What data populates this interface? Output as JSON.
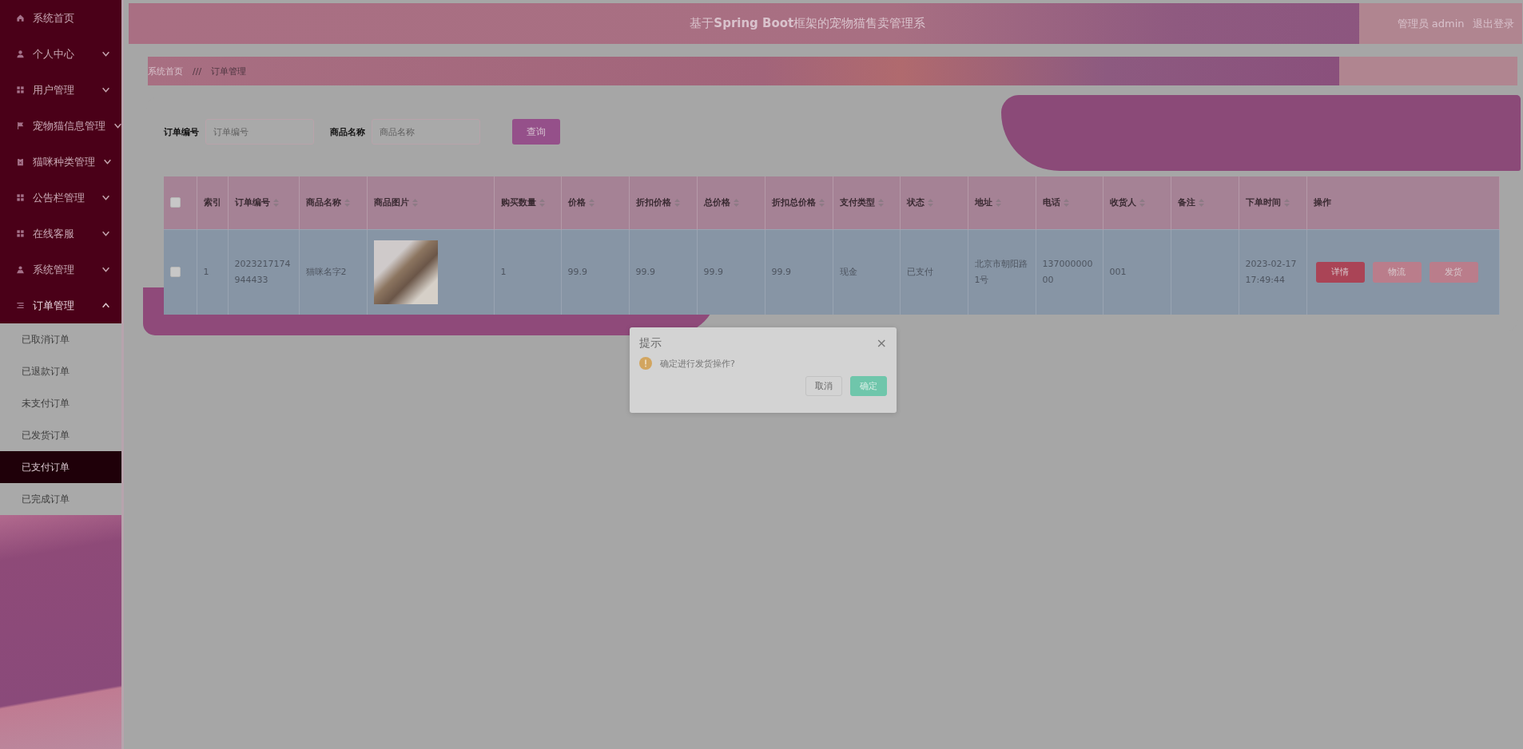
{
  "sidebar": {
    "items": [
      {
        "label": "系统首页",
        "kind": "link"
      },
      {
        "label": "个人中心",
        "kind": "menu",
        "expanded": false
      },
      {
        "label": "用户管理",
        "kind": "menu",
        "expanded": false
      },
      {
        "label": "宠物猫信息管理",
        "kind": "menu",
        "expanded": false
      },
      {
        "label": "猫咪种类管理",
        "kind": "menu",
        "expanded": false
      },
      {
        "label": "公告栏管理",
        "kind": "menu",
        "expanded": false
      },
      {
        "label": "在线客服",
        "kind": "menu",
        "expanded": false
      },
      {
        "label": "系统管理",
        "kind": "menu",
        "expanded": false
      },
      {
        "label": "订单管理",
        "kind": "menu",
        "expanded": true,
        "children": [
          {
            "label": "已取消订单",
            "selected": false
          },
          {
            "label": "已退款订单",
            "selected": false
          },
          {
            "label": "未支付订单",
            "selected": false
          },
          {
            "label": "已发货订单",
            "selected": false
          },
          {
            "label": "已支付订单",
            "selected": true
          },
          {
            "label": "已完成订单",
            "selected": false
          }
        ]
      }
    ]
  },
  "header": {
    "title": "基于**Spring Boot**框架的宠物猫售卖管理系",
    "user": "管理员 admin",
    "logout": "退出登录"
  },
  "breadcrumb": [
    "系统首页",
    "///",
    "订单管理"
  ],
  "filters": [
    {
      "label": "订单编号",
      "placeholder": "订单编号"
    },
    {
      "label": "商品名称",
      "placeholder": "商品名称"
    }
  ],
  "search_button": "查询",
  "table": {
    "columns": [
      {
        "kind": "checkbox",
        "sortable": false,
        "checked": false
      },
      {
        "label": "索引",
        "kind": "text",
        "sortable": false
      },
      {
        "label": "订单编号",
        "kind": "text",
        "sortable": true
      },
      {
        "label": "商品名称",
        "kind": "text",
        "sortable": true
      },
      {
        "label": "商品图片",
        "kind": "image",
        "sortable": true
      },
      {
        "label": "购买数量",
        "kind": "text",
        "sortable": true
      },
      {
        "label": "价格",
        "kind": "text",
        "sortable": true
      },
      {
        "label": "折扣价格",
        "kind": "text",
        "sortable": true
      },
      {
        "label": "总价格",
        "kind": "text",
        "sortable": true
      },
      {
        "label": "折扣总价格",
        "kind": "text",
        "sortable": true
      },
      {
        "label": "支付类型",
        "kind": "text",
        "sortable": true
      },
      {
        "label": "状态",
        "kind": "text",
        "sortable": true
      },
      {
        "label": "地址",
        "kind": "text",
        "sortable": true
      },
      {
        "label": "电话",
        "kind": "text",
        "sortable": true
      },
      {
        "label": "收货人",
        "kind": "text",
        "sortable": true
      },
      {
        "label": "备注",
        "kind": "text",
        "sortable": true
      },
      {
        "label": "下单时间",
        "kind": "text",
        "sortable": true
      },
      {
        "label": "操作",
        "kind": "actions",
        "sortable": false
      }
    ],
    "rows": [
      {
        "checked": false,
        "cells": [
          "",
          "1",
          "2023217174944433",
          "猫咪名字2",
          "",
          "1",
          "99.9",
          "99.9",
          "99.9",
          "99.9",
          "现金",
          "已支付",
          "北京市朝阳路1号",
          "13700000000",
          "001",
          "",
          "2023-02-17 17:49:44",
          ""
        ],
        "actions": [
          {
            "label": "详情",
            "kind": "primary"
          },
          {
            "label": "物流",
            "kind": "secondary"
          },
          {
            "label": "发货",
            "kind": "secondary"
          }
        ]
      }
    ]
  },
  "dialog": {
    "title": "提示",
    "close": "×",
    "message": "确定进行发货操作?",
    "buttons": [
      {
        "label": "取消",
        "kind": "cancel"
      },
      {
        "label": "确定",
        "kind": "confirm"
      }
    ]
  }
}
